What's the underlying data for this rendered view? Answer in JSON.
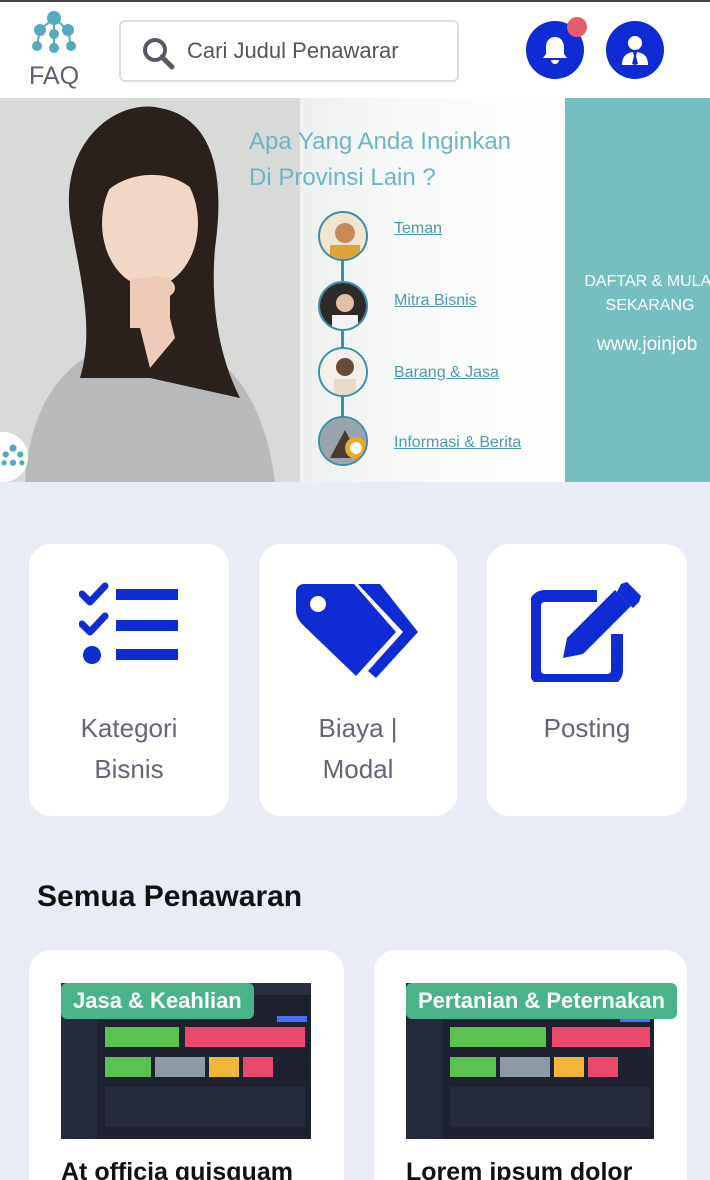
{
  "header": {
    "logo_label": "FAQ",
    "search_placeholder": "Cari Judul Penawarar",
    "accent_color": "#0f2bd3",
    "notification_dot_color": "#e85a6e"
  },
  "banner": {
    "headline_line1": "Apa Yang Anda Inginkan",
    "headline_line2": "Di Provinsi Lain ?",
    "options": [
      "Teman",
      "Mitra Bisnis",
      "Barang & Jasa",
      "Informasi & Berita"
    ],
    "cta_line1": "DAFTAR & MULAI",
    "cta_line2": "SEKARANG",
    "url": "www.joinjob"
  },
  "categories": [
    {
      "label_line1": "Kategori",
      "label_line2": "Bisnis",
      "icon": "list-check-icon"
    },
    {
      "label_line1": "Biaya |",
      "label_line2": "Modal",
      "icon": "tags-icon"
    },
    {
      "label_line1": "Posting",
      "label_line2": "",
      "icon": "edit-icon"
    }
  ],
  "offers_section": {
    "title": "Semua Penawaran",
    "items": [
      {
        "badge": "Jasa & Keahlian",
        "title": "At officia quisquam"
      },
      {
        "badge": "Pertanian & Peternakan",
        "title": "Lorem ipsum dolor"
      }
    ]
  }
}
